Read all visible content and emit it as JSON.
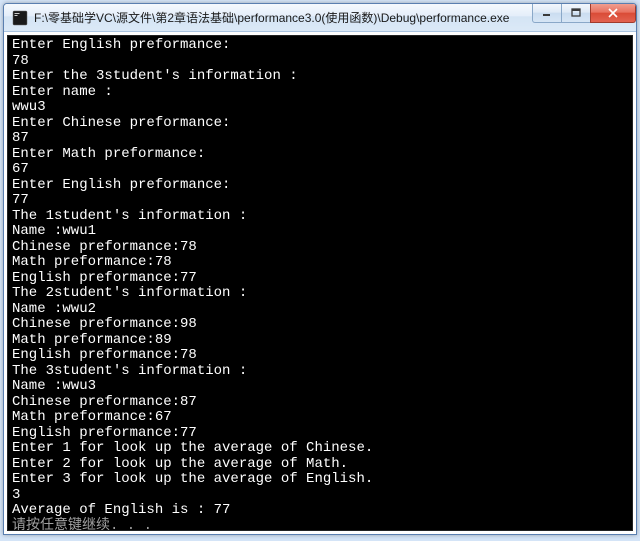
{
  "window": {
    "title": "F:\\零基础学VC\\源文件\\第2章语法基础\\performance3.0(使用函数)\\Debug\\performance.exe"
  },
  "console": {
    "lines": [
      "Enter English preformance:",
      "78",
      "Enter the 3student's information :",
      "Enter name :",
      "wwu3",
      "Enter Chinese preformance:",
      "87",
      "Enter Math preformance:",
      "67",
      "Enter English preformance:",
      "77",
      "The 1student's information :",
      "Name :wwu1",
      "Chinese preformance:78",
      "Math preformance:78",
      "English preformance:77",
      "The 2student's information :",
      "Name :wwu2",
      "Chinese preformance:98",
      "Math preformance:89",
      "English preformance:78",
      "The 3student's information :",
      "Name :wwu3",
      "Chinese preformance:87",
      "Math preformance:67",
      "English preformance:77",
      "Enter 1 for look up the average of Chinese.",
      "Enter 2 for look up the average of Math.",
      "Enter 3 for look up the average of English.",
      "3",
      "Average of English is : 77"
    ],
    "continue_hint": "请按任意键继续. . ."
  }
}
